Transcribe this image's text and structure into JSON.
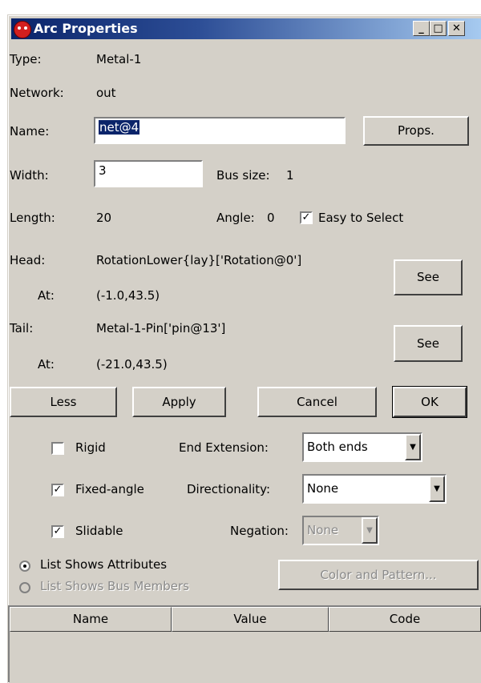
{
  "window": {
    "title": "Arc Properties",
    "controls": {
      "minimize": "_",
      "maximize": "□",
      "close": "✕"
    }
  },
  "info": {
    "type_label": "Type:",
    "type_value": "Metal-1",
    "network_label": "Network:",
    "network_value": "out",
    "name_label": "Name:",
    "name_value": "net@4",
    "props_button": "Props.",
    "width_label": "Width:",
    "width_value": "3",
    "bus_size_label": "Bus size:",
    "bus_size_value": "1",
    "length_label": "Length:",
    "length_value": "20",
    "angle_label": "Angle:",
    "angle_value": "0",
    "easy_select_label": "Easy to Select",
    "easy_select_checked": true,
    "head_label": "Head:",
    "head_value": "RotationLower{lay}['Rotation@0']",
    "head_at_label": "At:",
    "head_at_value": "(-1.0,43.5)",
    "head_see": "See",
    "tail_label": "Tail:",
    "tail_value": "Metal-1-Pin['pin@13']",
    "tail_at_label": "At:",
    "tail_at_value": "(-21.0,43.5)",
    "tail_see": "See"
  },
  "buttons": {
    "less": "Less",
    "apply": "Apply",
    "cancel": "Cancel",
    "ok": "OK"
  },
  "options": {
    "rigid_label": "Rigid",
    "rigid_checked": false,
    "fixed_angle_label": "Fixed-angle",
    "fixed_angle_checked": true,
    "slidable_label": "Slidable",
    "slidable_checked": true,
    "end_extension_label": "End Extension:",
    "end_extension_value": "Both ends",
    "directionality_label": "Directionality:",
    "directionality_value": "None",
    "negation_label": "Negation:",
    "negation_value": "None"
  },
  "list_mode": {
    "attributes_label": "List Shows Attributes",
    "attributes_selected": true,
    "bus_members_label": "List Shows Bus Members",
    "bus_members_selected": false,
    "color_pattern_button": "Color and Pattern..."
  },
  "table": {
    "columns": [
      "Name",
      "Value",
      "Code"
    ]
  }
}
